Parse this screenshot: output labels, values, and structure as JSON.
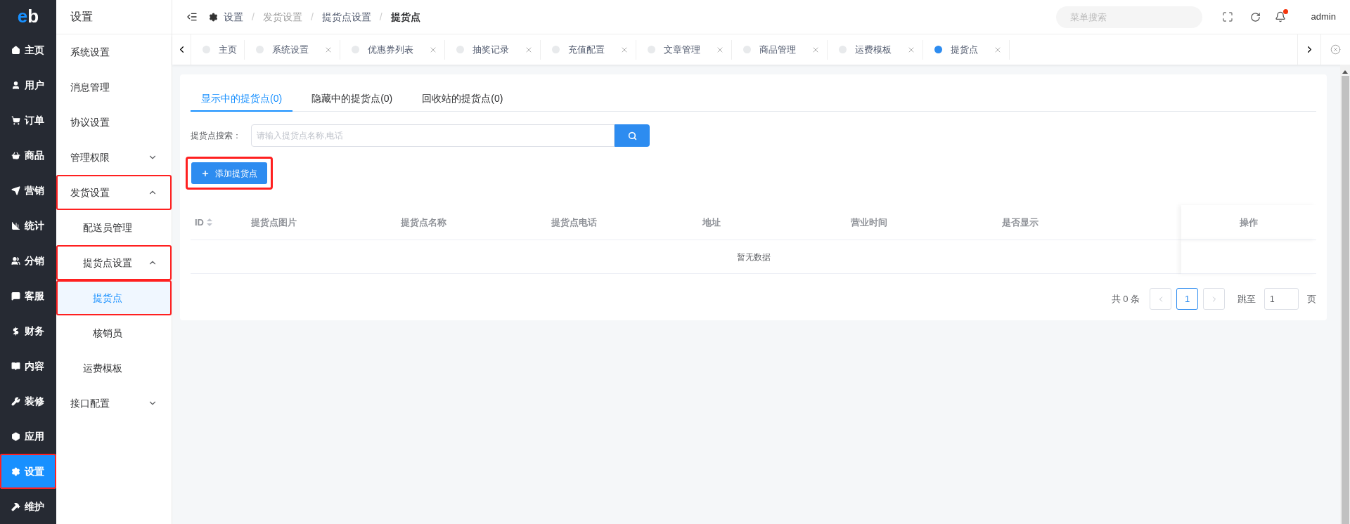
{
  "logo_parts": [
    "e",
    "b"
  ],
  "main_nav": [
    {
      "label": "主页",
      "selected": false,
      "highlighted": false
    },
    {
      "label": "用户",
      "selected": false,
      "highlighted": false
    },
    {
      "label": "订单",
      "selected": false,
      "highlighted": false
    },
    {
      "label": "商品",
      "selected": false,
      "highlighted": false
    },
    {
      "label": "营销",
      "selected": false,
      "highlighted": false
    },
    {
      "label": "统计",
      "selected": false,
      "highlighted": false
    },
    {
      "label": "分销",
      "selected": false,
      "highlighted": false
    },
    {
      "label": "客服",
      "selected": false,
      "highlighted": false
    },
    {
      "label": "财务",
      "selected": false,
      "highlighted": false
    },
    {
      "label": "内容",
      "selected": false,
      "highlighted": false
    },
    {
      "label": "装修",
      "selected": false,
      "highlighted": false
    },
    {
      "label": "应用",
      "selected": false,
      "highlighted": false
    },
    {
      "label": "设置",
      "selected": true,
      "highlighted": true
    },
    {
      "label": "维护",
      "selected": false,
      "highlighted": false
    }
  ],
  "sub_nav": {
    "title": "设置",
    "items": [
      {
        "label": "系统设置",
        "selected": false,
        "highlighted": false
      },
      {
        "label": "消息管理",
        "selected": false,
        "highlighted": false
      },
      {
        "label": "协议设置",
        "selected": false,
        "highlighted": false
      },
      {
        "label": "管理权限",
        "selected": false,
        "highlighted": false,
        "expanded": false
      },
      {
        "label": "发货设置",
        "selected": false,
        "highlighted": true,
        "expanded": true,
        "children": [
          {
            "label": "配送员管理",
            "selected": false,
            "highlighted": false
          },
          {
            "label": "提货点设置",
            "selected": false,
            "highlighted": true,
            "expanded": true,
            "children": [
              {
                "label": "提货点",
                "selected": true,
                "highlighted": true
              },
              {
                "label": "核销员",
                "selected": false,
                "highlighted": false
              }
            ]
          },
          {
            "label": "运费模板",
            "selected": false,
            "highlighted": false
          }
        ]
      },
      {
        "label": "接口配置",
        "selected": false,
        "highlighted": false,
        "expanded": false
      }
    ]
  },
  "breadcrumb": [
    {
      "label": "设置",
      "current": false
    },
    {
      "label": "发货设置",
      "current": false
    },
    {
      "label": "提货点设置",
      "current": false
    },
    {
      "label": "提货点",
      "current": true
    }
  ],
  "breadcrumb_separator": "/",
  "menu_search": {
    "placeholder": "菜单搜索"
  },
  "notification_dot": true,
  "user": "admin",
  "open_tabs": [
    {
      "label": "主页",
      "selected": false,
      "closable": false
    },
    {
      "label": "系统设置",
      "selected": false,
      "closable": true
    },
    {
      "label": "优惠券列表",
      "selected": false,
      "closable": true
    },
    {
      "label": "抽奖记录",
      "selected": false,
      "closable": true
    },
    {
      "label": "充值配置",
      "selected": false,
      "closable": true
    },
    {
      "label": "文章管理",
      "selected": false,
      "closable": true
    },
    {
      "label": "商品管理",
      "selected": false,
      "closable": true
    },
    {
      "label": "运费模板",
      "selected": false,
      "closable": true
    },
    {
      "label": "提货点",
      "selected": true,
      "closable": true
    }
  ],
  "content": {
    "tabs": [
      {
        "label": "显示中的提货点(0)",
        "selected": true
      },
      {
        "label": "隐藏中的提货点(0)",
        "selected": false
      },
      {
        "label": "回收站的提货点(0)",
        "selected": false
      }
    ],
    "search": {
      "label": "提货点搜索：",
      "placeholder": "请输入提货点名称,电话"
    },
    "add_button": {
      "label": "添加提货点",
      "highlighted": true
    },
    "table": {
      "columns": [
        {
          "label": "ID",
          "sortable": true
        },
        {
          "label": "提货点图片",
          "sortable": false
        },
        {
          "label": "提货点名称",
          "sortable": false
        },
        {
          "label": "提货点电话",
          "sortable": false
        },
        {
          "label": "地址",
          "sortable": false
        },
        {
          "label": "营业时间",
          "sortable": false
        },
        {
          "label": "是否显示",
          "sortable": false
        },
        {
          "label": "操作",
          "sortable": false
        }
      ],
      "empty_text": "暂无数据"
    },
    "pagination": {
      "total": "共 0 条",
      "pages": [
        {
          "label": "1",
          "selected": true
        }
      ],
      "jump_label": "跳至",
      "jump_value": "1",
      "page_unit": "页"
    }
  }
}
